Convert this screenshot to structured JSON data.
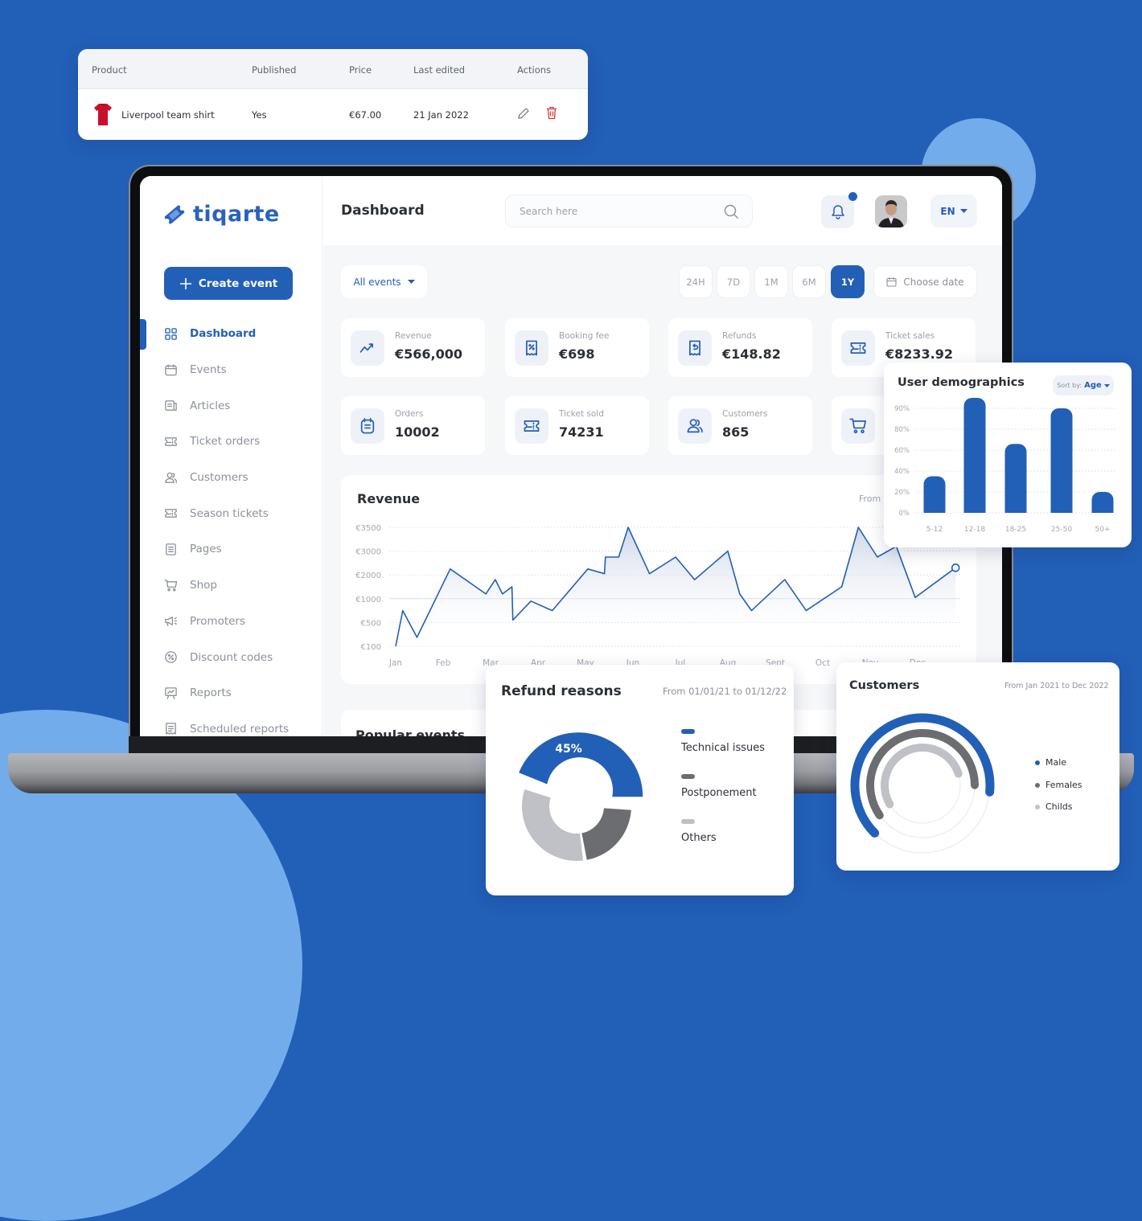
{
  "colors": {
    "background": "#225fb7",
    "accent": "#225fb7",
    "blob": "#72acea",
    "dark_gray": "#6c6d70",
    "light_gray": "#bfc1c6",
    "danger": "#d63939"
  },
  "product_table": {
    "headers": [
      "Product",
      "Published",
      "Price",
      "Last edited",
      "Actions"
    ],
    "rows": [
      {
        "product": "Liverpool team shirt",
        "published": "Yes",
        "price": "€67.00",
        "last_edited": "21 Jan 2022",
        "actions": [
          "edit-icon",
          "delete-icon"
        ]
      }
    ]
  },
  "sidebar": {
    "logo": "tiqarte",
    "create_button": "Create event",
    "items": [
      {
        "label": "Dashboard",
        "icon": "grid-icon",
        "active": true
      },
      {
        "label": "Events",
        "icon": "calendar-icon",
        "active": false
      },
      {
        "label": "Articles",
        "icon": "article-icon",
        "active": false
      },
      {
        "label": "Ticket orders",
        "icon": "ticket-icon",
        "active": false
      },
      {
        "label": "Customers",
        "icon": "users-icon",
        "active": false
      },
      {
        "label": "Season tickets",
        "icon": "ticket-icon",
        "active": false
      },
      {
        "label": "Pages",
        "icon": "page-icon",
        "active": false
      },
      {
        "label": "Shop",
        "icon": "cart-icon",
        "active": false
      },
      {
        "label": "Promoters",
        "icon": "megaphone-icon",
        "active": false
      },
      {
        "label": "Discount codes",
        "icon": "percent-icon",
        "active": false
      },
      {
        "label": "Reports",
        "icon": "presentation-icon",
        "active": false
      },
      {
        "label": "Scheduled reports",
        "icon": "receipt-icon",
        "active": false
      }
    ]
  },
  "header": {
    "title": "Dashboard",
    "search_placeholder": "Search here",
    "language": "EN",
    "has_notification": true
  },
  "filters": {
    "events_dropdown": "All events",
    "periods": [
      "24H",
      "7D",
      "1M",
      "6M",
      "1Y"
    ],
    "active_period": "1Y",
    "choose_date": "Choose date"
  },
  "stats": [
    {
      "label": "Revenue",
      "value": "€566,000",
      "icon": "trend-up-icon"
    },
    {
      "label": "Booking fee",
      "value": "€698",
      "icon": "receipt-percent-icon"
    },
    {
      "label": "Refunds",
      "value": "€148.82",
      "icon": "receipt-refund-icon"
    },
    {
      "label": "Ticket sales",
      "value": "€8233.92",
      "icon": "ticket-icon"
    },
    {
      "label": "Orders",
      "value": "10002",
      "icon": "clipboard-icon"
    },
    {
      "label": "Ticket sold",
      "value": "74231",
      "icon": "ticket-icon"
    },
    {
      "label": "Customers",
      "value": "865",
      "icon": "users-icon"
    },
    {
      "label": "",
      "value": "",
      "icon": "cart-icon"
    }
  ],
  "revenue": {
    "title": "Revenue",
    "from_label": "From",
    "popular_events_title": "Popular events"
  },
  "refund_reasons": {
    "title": "Refund reasons",
    "range": "From 01/01/21 to 01/12/22",
    "highlight_label": "45%"
  },
  "customers_card": {
    "title": "Customers",
    "range": "From Jan 2021 to Dec 2022"
  },
  "demographics": {
    "title": "User demographics",
    "sort_prefix": "Sort by:",
    "sort_value": "Age"
  },
  "chart_data": [
    {
      "type": "area",
      "title": "Revenue",
      "xlabel": "",
      "ylabel": "",
      "y_tick_labels": [
        "€100",
        "€500",
        "€1000",
        "€2000",
        "€3000",
        "€3500"
      ],
      "y_ticks_note": "ticks evenly spaced (categorical-style scale)",
      "x_tick_labels": [
        "Jan",
        "Feb",
        "Mar",
        "Apr",
        "May",
        "Jun",
        "Jul",
        "Aug",
        "Sept",
        "Oct",
        "Nov",
        "Dec"
      ],
      "grid": true,
      "series": [
        {
          "name": "Revenue",
          "points": [
            [
              0.0,
              100
            ],
            [
              0.15,
              750
            ],
            [
              0.45,
              250
            ],
            [
              1.15,
              2250
            ],
            [
              1.9,
              1200
            ],
            [
              2.1,
              1800
            ],
            [
              2.25,
              1200
            ],
            [
              2.45,
              1500
            ],
            [
              2.47,
              550
            ],
            [
              2.85,
              950
            ],
            [
              3.3,
              750
            ],
            [
              4.05,
              2250
            ],
            [
              4.4,
              2050
            ],
            [
              4.42,
              2750
            ],
            [
              4.7,
              2750
            ],
            [
              4.9,
              3500
            ],
            [
              5.35,
              2050
            ],
            [
              5.9,
              2750
            ],
            [
              6.3,
              1800
            ],
            [
              7.0,
              3000
            ],
            [
              7.25,
              1200
            ],
            [
              7.5,
              750
            ],
            [
              8.2,
              1800
            ],
            [
              8.65,
              750
            ],
            [
              9.4,
              1500
            ],
            [
              9.75,
              3500
            ],
            [
              10.15,
              2750
            ],
            [
              10.55,
              3100
            ],
            [
              10.95,
              1050
            ],
            [
              11.8,
              2300
            ]
          ]
        }
      ]
    },
    {
      "type": "bar",
      "title": "User demographics",
      "categories": [
        "5-12",
        "12-18",
        "18-25",
        "25-50",
        "50+"
      ],
      "values": [
        35,
        95,
        66,
        90,
        20
      ],
      "y_tick_labels": [
        "0%",
        "20%",
        "40%",
        "60%",
        "80%",
        "90%"
      ],
      "ylim": [
        0,
        100
      ],
      "grid": true
    },
    {
      "type": "pie",
      "title": "Refund reasons",
      "categories": [
        "Technical issues",
        "Postponement",
        "Others"
      ],
      "values": [
        45,
        22,
        33
      ],
      "donut": true,
      "legend": "right"
    },
    {
      "type": "pie",
      "title": "Customers",
      "subtype": "radial-bar",
      "categories": [
        "Male",
        "Females",
        "Childs"
      ],
      "values": [
        62,
        55,
        45
      ],
      "unit": "percent of ring",
      "legend": "right"
    }
  ]
}
